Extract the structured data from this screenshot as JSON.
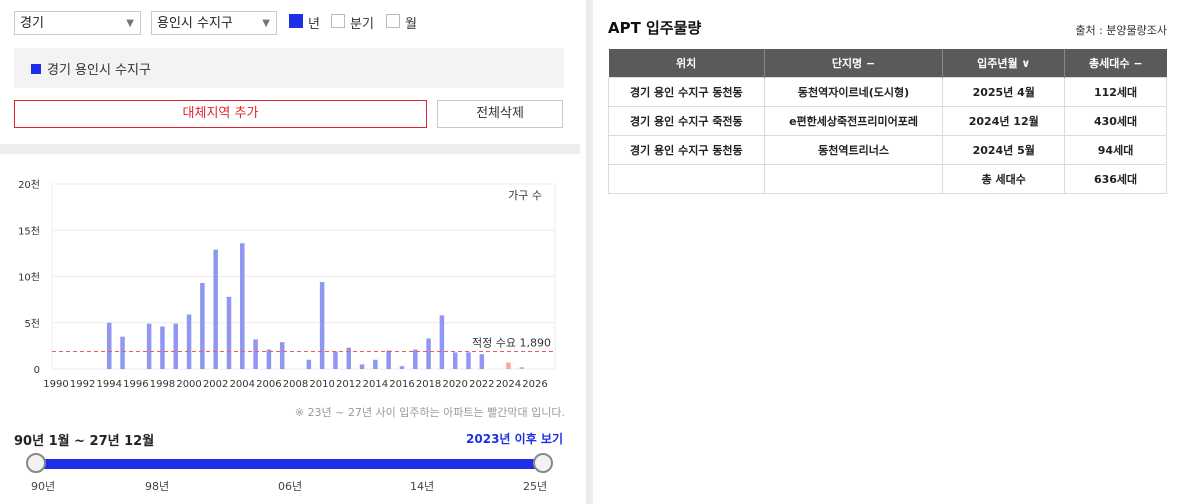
{
  "filters": {
    "province": "경기",
    "district": "용인시 수지구",
    "period_options": [
      {
        "label": "년",
        "checked": true
      },
      {
        "label": "분기",
        "checked": false
      },
      {
        "label": "월",
        "checked": false
      }
    ]
  },
  "selected_region": "경기 용인시 수지구",
  "buttons": {
    "add_region": "대체지역 추가",
    "delete_all": "전체삭제"
  },
  "chart_data": {
    "type": "bar",
    "title": "",
    "unit_label": "가구 수",
    "x_tick_labels": [
      "1990",
      "1992",
      "1994",
      "1996",
      "1998",
      "2000",
      "2002",
      "2004",
      "2006",
      "2008",
      "2010",
      "2012",
      "2014",
      "2016",
      "2018",
      "2020",
      "2022",
      "2024",
      "2026"
    ],
    "y_tick_labels": [
      "0",
      "5천",
      "10천",
      "15천",
      "20천"
    ],
    "ylim": [
      0,
      20000
    ],
    "categories": [
      "1990",
      "1991",
      "1992",
      "1993",
      "1994",
      "1995",
      "1996",
      "1997",
      "1998",
      "1999",
      "2000",
      "2001",
      "2002",
      "2003",
      "2004",
      "2005",
      "2006",
      "2007",
      "2008",
      "2009",
      "2010",
      "2011",
      "2012",
      "2013",
      "2014",
      "2015",
      "2016",
      "2017",
      "2018",
      "2019",
      "2020",
      "2021",
      "2022",
      "2023",
      "2024",
      "2025",
      "2026",
      "2027"
    ],
    "values": [
      0,
      0,
      0,
      0,
      5000,
      3500,
      0,
      4900,
      4600,
      4900,
      5900,
      9300,
      12900,
      7800,
      13600,
      3200,
      2100,
      2900,
      0,
      1000,
      9400,
      1900,
      2300,
      500,
      1000,
      2000,
      300,
      2100,
      3300,
      5800,
      1800,
      1800,
      1600,
      0,
      700,
      200,
      0,
      0
    ],
    "highlight_from": "2023",
    "colors": {
      "bar": "#8f97f0",
      "highlight": "#f6a8a2",
      "reference": "#f05a5a",
      "grid": "#ececec"
    },
    "reference_line": {
      "value": 1890,
      "label": "적정 수요 1,890"
    }
  },
  "note": "※ 23년 ~ 27년 사이 입주하는 아파트는 빨간막대 입니다.",
  "period_range": "90년 1월 ~ 27년 12월",
  "after_link": "2023년 이후 보기",
  "slider": {
    "labels": [
      "90년",
      "98년",
      "06년",
      "14년",
      "25년"
    ],
    "range": [
      "90년",
      "25년"
    ]
  },
  "right": {
    "title": "APT 입주물량",
    "source": "출처 : 분양물량조사",
    "table": {
      "headers": [
        "위치",
        "단지명 −",
        "입주년월 ∨",
        "총세대수 −"
      ],
      "rows": [
        [
          "경기 용인 수지구 동천동",
          "동천역자이르네(도시형)",
          "2025년 4월",
          "112세대"
        ],
        [
          "경기 용인 수지구 죽전동",
          "e편한세상죽전프리미어포레",
          "2024년 12월",
          "430세대"
        ],
        [
          "경기 용인 수지구 동천동",
          "동천역트리너스",
          "2024년 5월",
          "94세대"
        ]
      ],
      "total_label": "총 세대수",
      "total_value": "636세대"
    }
  }
}
